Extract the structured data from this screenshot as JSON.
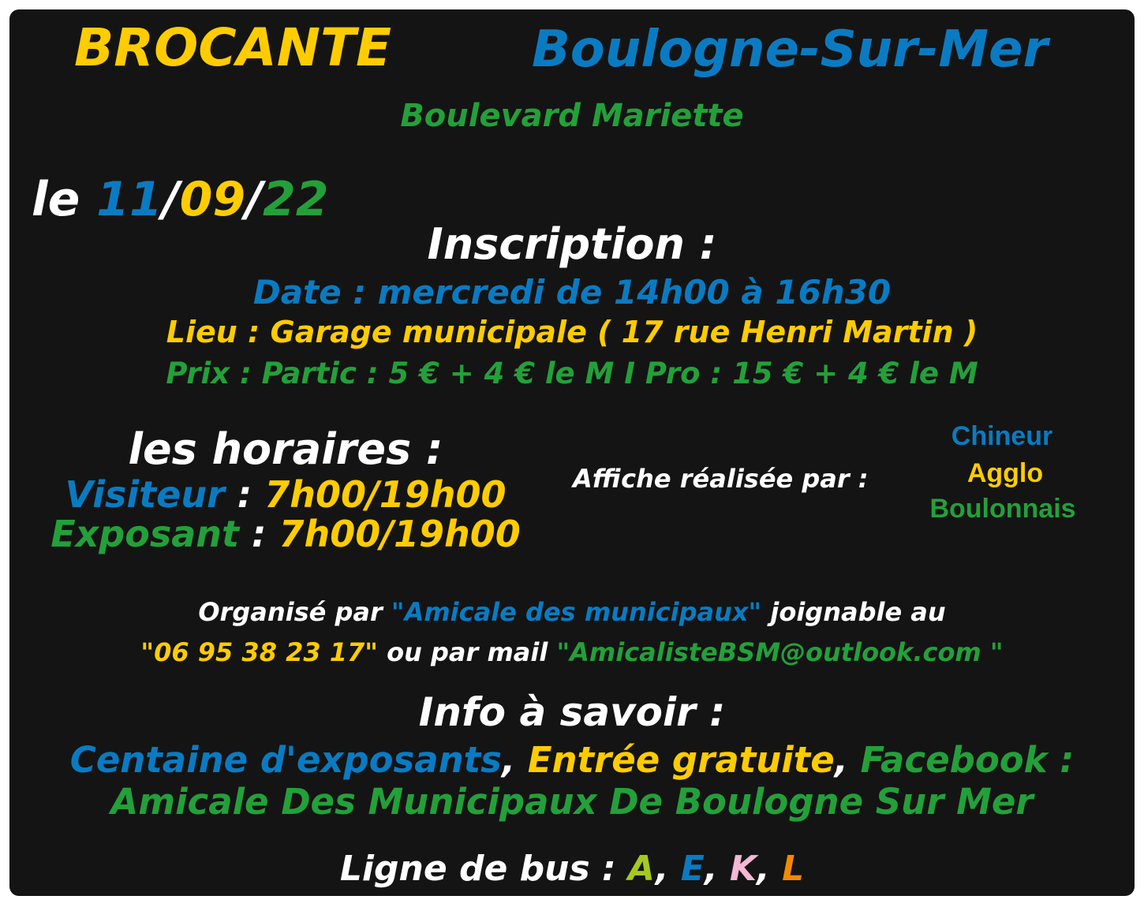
{
  "header": {
    "brocante": "BROCANTE",
    "city": "Boulogne-Sur-Mer",
    "street": "Boulevard Mariette"
  },
  "date": {
    "prefix": "le ",
    "day": "11",
    "sep1": "/",
    "month": "09",
    "sep2": "/",
    "year": "22"
  },
  "inscription": {
    "title": "Inscription :",
    "date_label": "Date : ",
    "date_value": " mercredi de 14h00 à 16h30",
    "lieu_label": "Lieu : ",
    "lieu_value": "Garage municipale ( 17 rue Henri Martin )",
    "prix": "Prix : Partic : 5 € + 4 € le M I Pro : 15 € + 4 € le M"
  },
  "horaires": {
    "title": "les horaires :",
    "visiteur_label": "Visiteur",
    "visiteur_sep": " : ",
    "visiteur_value": "7h00/19h00",
    "exposant_label": "Exposant",
    "exposant_sep": " : ",
    "exposant_value": "7h00/19h00"
  },
  "credit": {
    "label": "Affiche réalisée par :",
    "line1": "Chineur",
    "line2": "Agglo",
    "line3": "Boulonnais"
  },
  "organizer": {
    "part1": "Organisé par ",
    "name": "\"Amicale des municipaux\"",
    "part2": " joignable au",
    "phone": "\"06 95 38 23 17\"",
    "part3": " ou par mail ",
    "email": "\"AmicalisteBSM@outlook.com \""
  },
  "info": {
    "title": "Info à savoir :",
    "item1": "Centaine d'exposants",
    "comma1": ", ",
    "item2": "Entrée gratuite",
    "comma2": ", ",
    "item3": "Facebook :",
    "facebook_page": "Amicale Des Municipaux De Boulogne Sur Mer"
  },
  "bus": {
    "label": "Ligne de bus : ",
    "line_a": "A",
    "line_e": "E",
    "line_k": "K",
    "line_l": "L",
    "comma": ", "
  },
  "colors": {
    "background": "#141414",
    "blue": "#0a7bc2",
    "yellow": "#ffcc00",
    "green": "#23a03a",
    "white": "#ffffff"
  }
}
